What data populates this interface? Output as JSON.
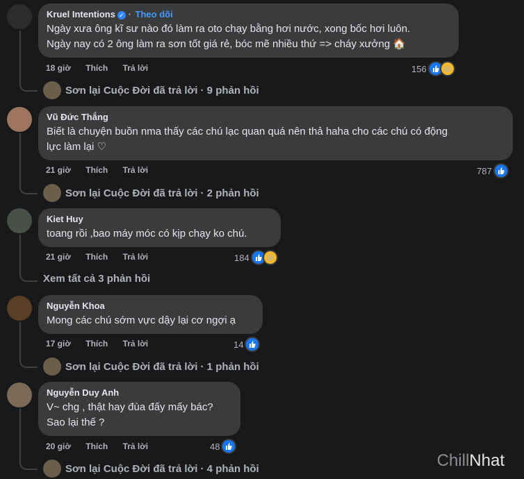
{
  "comments": [
    {
      "name": "Kruel Intentions",
      "follow": "Theo dõi",
      "lines": [
        "Ngày xưa ông kĩ sư nào đó làm ra oto chạy bằng hơi nước, xong bốc hơi luôn.",
        "Ngày nay có 2 ông làm ra sơn tốt giá rẻ, bóc mẽ nhiều thứ => cháy xưởng 🏠"
      ],
      "time": "18 giờ",
      "like": "Thích",
      "reply": "Trả lời",
      "count": "156",
      "replies": "Sơn lại Cuộc Đời đã trả lời · 9 phản hồi"
    },
    {
      "name": "Vũ Đức Thắng",
      "lines": [
        "Biết là chuyện buồn nma thấy các chú lạc quan quá nên thả haha cho các chú có động",
        "lực làm lại ♡"
      ],
      "time": "21 giờ",
      "like": "Thích",
      "reply": "Trả lời",
      "count": "787",
      "replies": "Sơn lại Cuộc Đời đã trả lời · 2 phản hồi"
    },
    {
      "name": "Kiet Huy",
      "lines": [
        "toang rồi ,bao máy móc có kịp chạy ko chú."
      ],
      "time": "21 giờ",
      "like": "Thích",
      "reply": "Trả lời",
      "count": "184",
      "replies": "Xem tất cả 3 phản hồi"
    },
    {
      "name": "Nguyễn Khoa",
      "lines": [
        "Mong các chú sớm vực dậy lại cơ ngợi ạ"
      ],
      "time": "17 giờ",
      "like": "Thích",
      "reply": "Trả lời",
      "count": "14",
      "replies": "Sơn lại Cuộc Đời đã trả lời · 1 phản hồi"
    },
    {
      "name": "Nguyễn Duy Anh",
      "lines": [
        "V~ chg , thật hay đùa đấy mấy bác?",
        "Sao lại thế ?"
      ],
      "time": "20 giờ",
      "like": "Thích",
      "reply": "Trả lời",
      "count": "48",
      "replies": "Sơn lại Cuộc Đời đã trả lời · 4 phản hồi"
    }
  ],
  "watermark": {
    "part1": "Chill",
    "part2": "Nhat"
  },
  "icons": {
    "verified": "verified-badge-icon",
    "like": "like-icon",
    "haha": "haha-icon"
  },
  "colors": {
    "background": "#18191a",
    "bubble": "#3a3b3c",
    "link": "#4599ff",
    "like": "#1877f2",
    "haha": "#f7b928"
  }
}
